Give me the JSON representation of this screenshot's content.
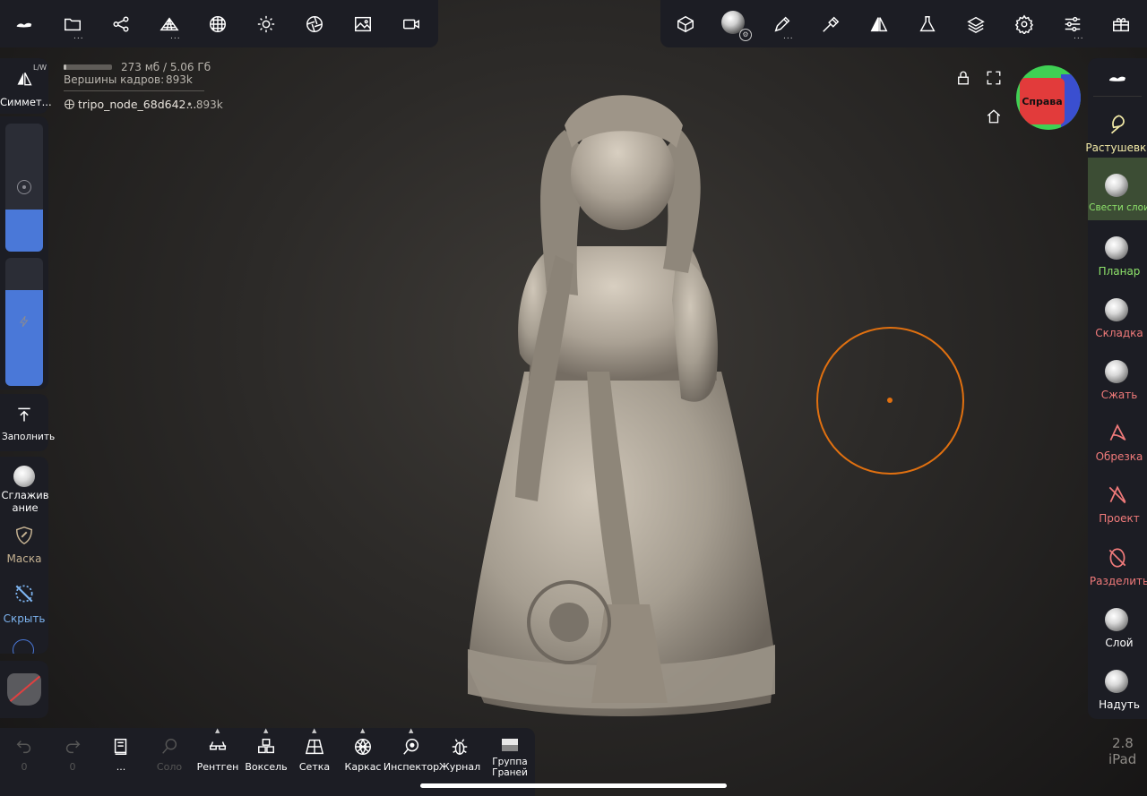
{
  "top_left_toolbar": {
    "items": [
      {
        "name": "nomad-logo-icon",
        "dots": ""
      },
      {
        "name": "folder-icon",
        "dots": "..."
      },
      {
        "name": "scene-graph-icon",
        "dots": ""
      },
      {
        "name": "mesh-icon",
        "dots": "..."
      },
      {
        "name": "topology-icon",
        "dots": ""
      },
      {
        "name": "light-icon",
        "dots": ""
      },
      {
        "name": "aperture-icon",
        "dots": ""
      },
      {
        "name": "image-icon",
        "dots": ""
      },
      {
        "name": "camera-icon",
        "dots": ""
      }
    ]
  },
  "top_right_toolbar": {
    "items": [
      {
        "name": "cube-icon",
        "dots": ""
      },
      {
        "name": "material-sphere-icon",
        "dots": ""
      },
      {
        "name": "brush-icon",
        "dots": "..."
      },
      {
        "name": "hammer-icon",
        "dots": ""
      },
      {
        "name": "symmetry-icon",
        "dots": ""
      },
      {
        "name": "flask-icon",
        "dots": ""
      },
      {
        "name": "layers-icon",
        "dots": ""
      },
      {
        "name": "settings-icon",
        "dots": ""
      },
      {
        "name": "sliders-icon",
        "dots": "..."
      },
      {
        "name": "gift-icon",
        "dots": ""
      }
    ]
  },
  "stats": {
    "memory": "273 мб / 5.06 Гб",
    "vertices_label": "Вершины кадров:",
    "vertices_value": "893k",
    "node_name": "tripo_node_68d642...",
    "node_vertices": "• 893k",
    "memory_fraction": 0.06
  },
  "left_panel": {
    "symmetry_label": "Симмет...",
    "symmetry_badge": "L/W",
    "slider_radius_fill": 0.33,
    "slider_intensity_fill": 0.75,
    "fill_label": "Заполнить",
    "smooth_label": "Сглаживание",
    "mask_label": "Маска",
    "hide_label": "Скрыть"
  },
  "right_panel": {
    "tools": [
      {
        "name": "tool-rastushevka",
        "label": "Растушевка",
        "color": "#f1e9a6",
        "active": false
      },
      {
        "name": "tool-svesti-sloi",
        "label": "Свести слои",
        "color": "#8ee36b",
        "active": true
      },
      {
        "name": "tool-planar",
        "label": "Планар",
        "color": "#8ee36b",
        "active": false
      },
      {
        "name": "tool-skladka",
        "label": "Складка",
        "color": "#f07a7a",
        "active": false
      },
      {
        "name": "tool-szhat",
        "label": "Сжать",
        "color": "#f07a7a",
        "active": false
      },
      {
        "name": "tool-obrezka",
        "label": "Обрезка",
        "color": "#f07a7a",
        "active": false
      },
      {
        "name": "tool-proekt",
        "label": "Проект",
        "color": "#f07a7a",
        "active": false
      },
      {
        "name": "tool-razdelit",
        "label": "Разделить",
        "color": "#f07a7a",
        "active": false
      },
      {
        "name": "tool-sloy",
        "label": "Слой",
        "color": "#ffffff",
        "active": false
      },
      {
        "name": "tool-naduts",
        "label": "Надуть",
        "color": "#ffffff",
        "active": false
      }
    ]
  },
  "gizmo": {
    "label": "Справа",
    "front_color": "#e23b3b",
    "top_color": "#3fd054",
    "side_color": "#3a4fd0"
  },
  "bottom_toolbar": {
    "undo": {
      "label": "0"
    },
    "redo": {
      "label": "0"
    },
    "menu": {
      "label": "..."
    },
    "solo": {
      "label": "Соло"
    },
    "xray": {
      "label": "Рентген"
    },
    "voxel": {
      "label": "Воксель"
    },
    "grid": {
      "label": "Сетка"
    },
    "wireframe": {
      "label": "Каркас"
    },
    "inspector": {
      "label": "Инспектор"
    },
    "journal": {
      "label": "Журнал"
    },
    "facegroup": {
      "label": "Группа Граней"
    }
  },
  "version": {
    "number": "2.8",
    "device": "iPad"
  },
  "brush_color": "#e07010"
}
